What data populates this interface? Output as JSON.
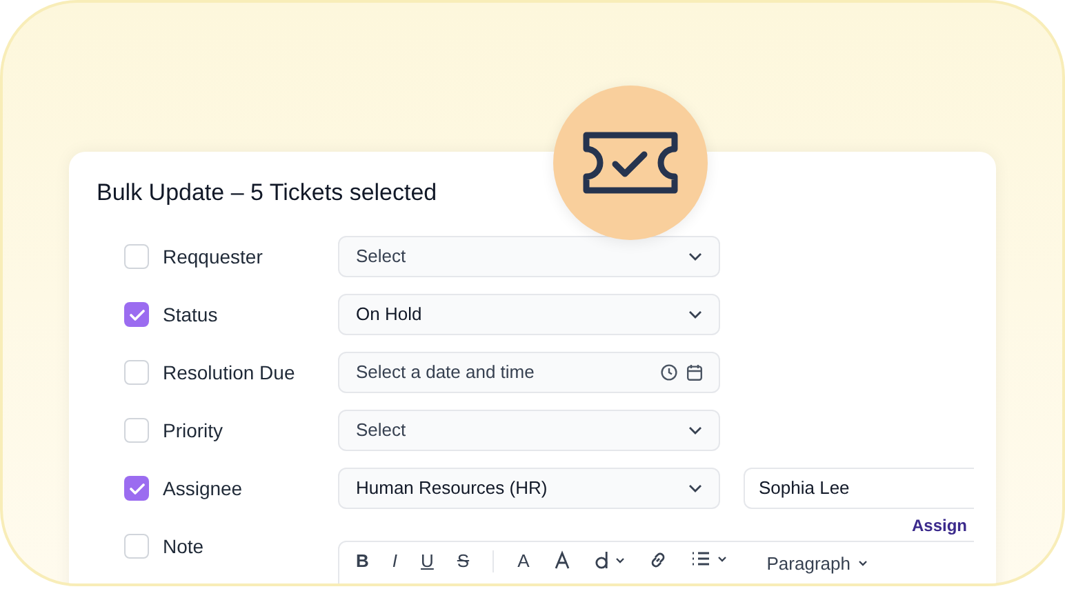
{
  "title": "Bulk Update – 5 Tickets selected",
  "fields": [
    {
      "label": "Reqquester",
      "checked": false,
      "kind": "select",
      "placeholder": "Select"
    },
    {
      "label": "Status",
      "checked": true,
      "kind": "select",
      "value": "On Hold"
    },
    {
      "label": "Resolution Due",
      "checked": false,
      "kind": "datetime",
      "placeholder": "Select a date and time"
    },
    {
      "label": "Priority",
      "checked": false,
      "kind": "select",
      "placeholder": "Select"
    },
    {
      "label": "Assignee",
      "checked": true,
      "kind": "select",
      "value": "Human Resources (HR)",
      "agent": "Sophia Lee",
      "link": "Assign"
    },
    {
      "label": "Note",
      "checked": false,
      "kind": "editor"
    }
  ],
  "editor_toolbar": {
    "formats": [
      "B",
      "I",
      "U",
      "S",
      "A"
    ],
    "block_format": "Paragraph"
  }
}
